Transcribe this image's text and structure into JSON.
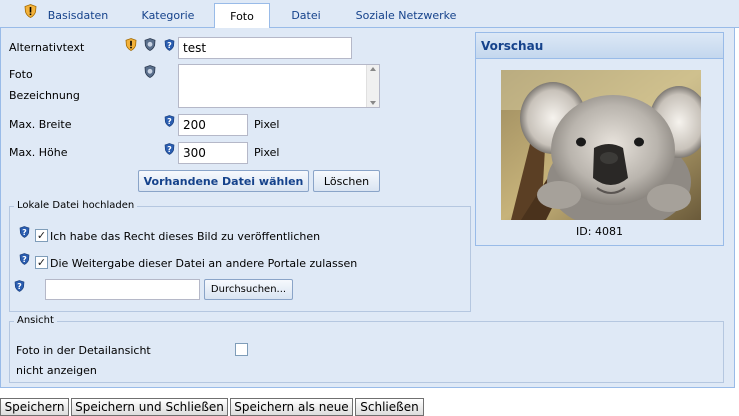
{
  "tabs": [
    {
      "label": "Basisdaten"
    },
    {
      "label": "Kategorie"
    },
    {
      "label": "Foto"
    },
    {
      "label": "Datei"
    },
    {
      "label": "Soziale Netzwerke"
    }
  ],
  "form": {
    "alt_label": "Alternativtext",
    "alt_value": "test",
    "foto_label_1": "Foto",
    "foto_label_2": "Bezeichnung",
    "foto_value": "",
    "max_width_label": "Max. Breite",
    "max_width_value": "200",
    "max_height_label": "Max. Höhe",
    "max_height_value": "300",
    "unit": "Pixel",
    "choose_button": "Vorhandene Datei wählen",
    "delete_button": "Löschen"
  },
  "upload": {
    "legend": "Lokale Datei hochladen",
    "rights_label": "Ich habe das Recht dieses Bild zu veröffentlichen",
    "rights_checked": true,
    "share_label": "Die Weitergabe dieser Datei an andere Portale zulassen",
    "share_checked": true,
    "file_value": "",
    "browse_button": "Durchsuchen..."
  },
  "view": {
    "legend": "Ansicht",
    "hide_label_1": "Foto in der Detailansicht",
    "hide_label_2": "nicht anzeigen",
    "hide_checked": false
  },
  "preview": {
    "title": "Vorschau",
    "id_text": "ID: 4081"
  },
  "bottom_buttons": {
    "save": "Speichern",
    "save_close": "Speichern und Schließen",
    "save_new": "Speichern als neue",
    "close": "Schließen"
  },
  "colors": {
    "panel_bg": "#dfe9f6",
    "border": "#99bbe8",
    "title_text": "#15428b",
    "warning_icon": "#f5a623",
    "help_icon": "#2a5db0"
  }
}
